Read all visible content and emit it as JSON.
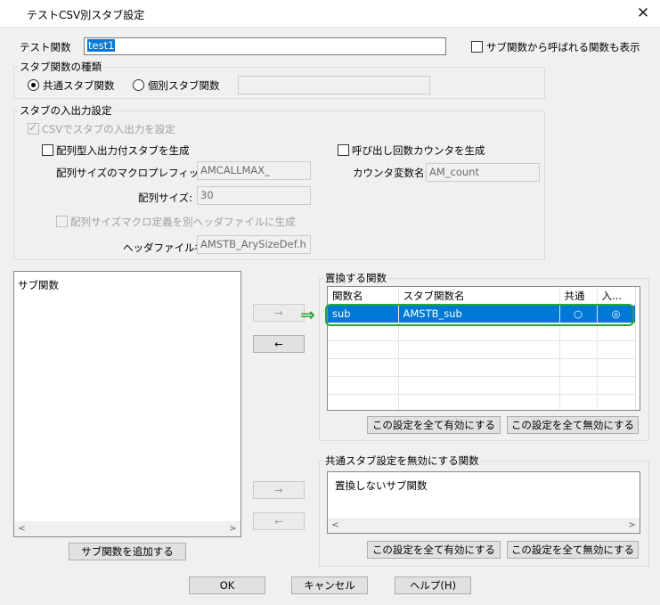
{
  "window": {
    "title": "テストCSV別スタブ設定",
    "close_glyph": "✕"
  },
  "test_func": {
    "label": "テスト関数",
    "value": "test1"
  },
  "show_called": {
    "label": "サブ関数から呼ばれる関数も表示",
    "checked": false
  },
  "stub_kind": {
    "title": "スタブ関数の種類",
    "common_label": "共通スタブ関数",
    "individual_label": "個別スタブ関数",
    "selected": "common",
    "individual_value": ""
  },
  "io": {
    "title": "スタブの入出力設定",
    "csv_label": "CSVでスタブの入出力を設定",
    "array_label": "配列型入出力付スタブを生成",
    "array_prefix_label": "配列サイズのマクロプレフィックス:",
    "array_prefix_value": "AMCALLMAX_",
    "array_size_label": "配列サイズ:",
    "array_size_value": "30",
    "macro_file_label": "配列サイズマクロ定義を別ヘッダファイルに生成",
    "header_label": "ヘッダファイル名:",
    "header_value": "AMSTB_ArySizeDef.h",
    "counter_label": "呼び出し回数カウンタを生成",
    "counter_var_label": "カウンタ変数名:",
    "counter_var_value": "AM_count"
  },
  "sub_list": {
    "header": "サブ関数",
    "add_button": "サブ関数を追加する"
  },
  "arrows": {
    "right": "→",
    "left": "←"
  },
  "replace": {
    "title": "置換する関数",
    "columns": [
      "関数名",
      "スタブ関数名",
      "共通",
      "入..."
    ],
    "rows": [
      {
        "func": "sub",
        "stub": "AMSTB_sub",
        "common": "○",
        "io": "◎"
      }
    ],
    "enable_all": "この設定を全て有効にする",
    "disable_all": "この設定を全て無効にする"
  },
  "no_common": {
    "title": "共通スタブ設定を無効にする関数",
    "header": "置換しないサブ関数",
    "enable_all": "この設定を全て有効にする",
    "disable_all": "この設定を全て無効にする"
  },
  "footer": {
    "ok": "OK",
    "cancel": "キャンセル",
    "help": "ヘルプ(H)"
  },
  "scroll": {
    "left": "<",
    "right": ">"
  },
  "annotation": {
    "arrow": "⇒"
  },
  "colors": {
    "selection": "#0078d7",
    "highlight": "#22a838"
  }
}
